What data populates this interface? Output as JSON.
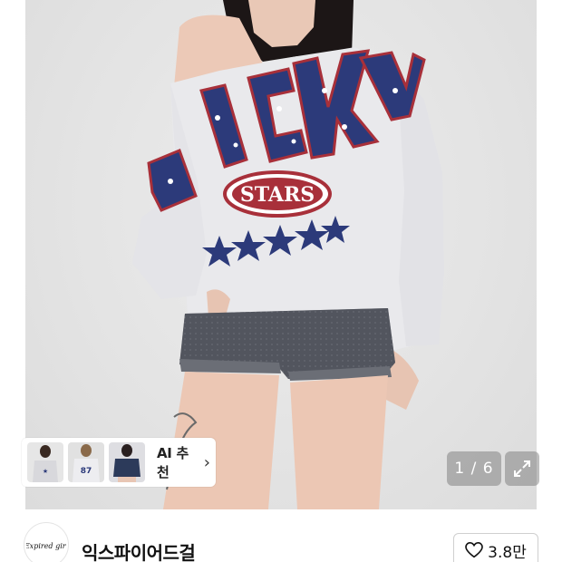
{
  "product_image": {
    "shirt_print_top": "UCKY",
    "shirt_print_badge": "STARS"
  },
  "ai_recommend": {
    "label": "AI 추천",
    "chevron": "›",
    "thumbnails": [
      "thumb-1",
      "thumb-2",
      "thumb-3"
    ]
  },
  "gallery": {
    "counter": "1 / 6",
    "expand_icon": "expand-icon"
  },
  "store": {
    "name": "익스파이어드걸",
    "logo_text": "Expired girl",
    "like_count": "3.8만",
    "heart_icon": "heart-icon"
  },
  "colors": {
    "navy": "#2c3a7a",
    "red": "#a8303a",
    "sweatshirt": "#e9e9ec",
    "denim": "#4a4d55"
  }
}
